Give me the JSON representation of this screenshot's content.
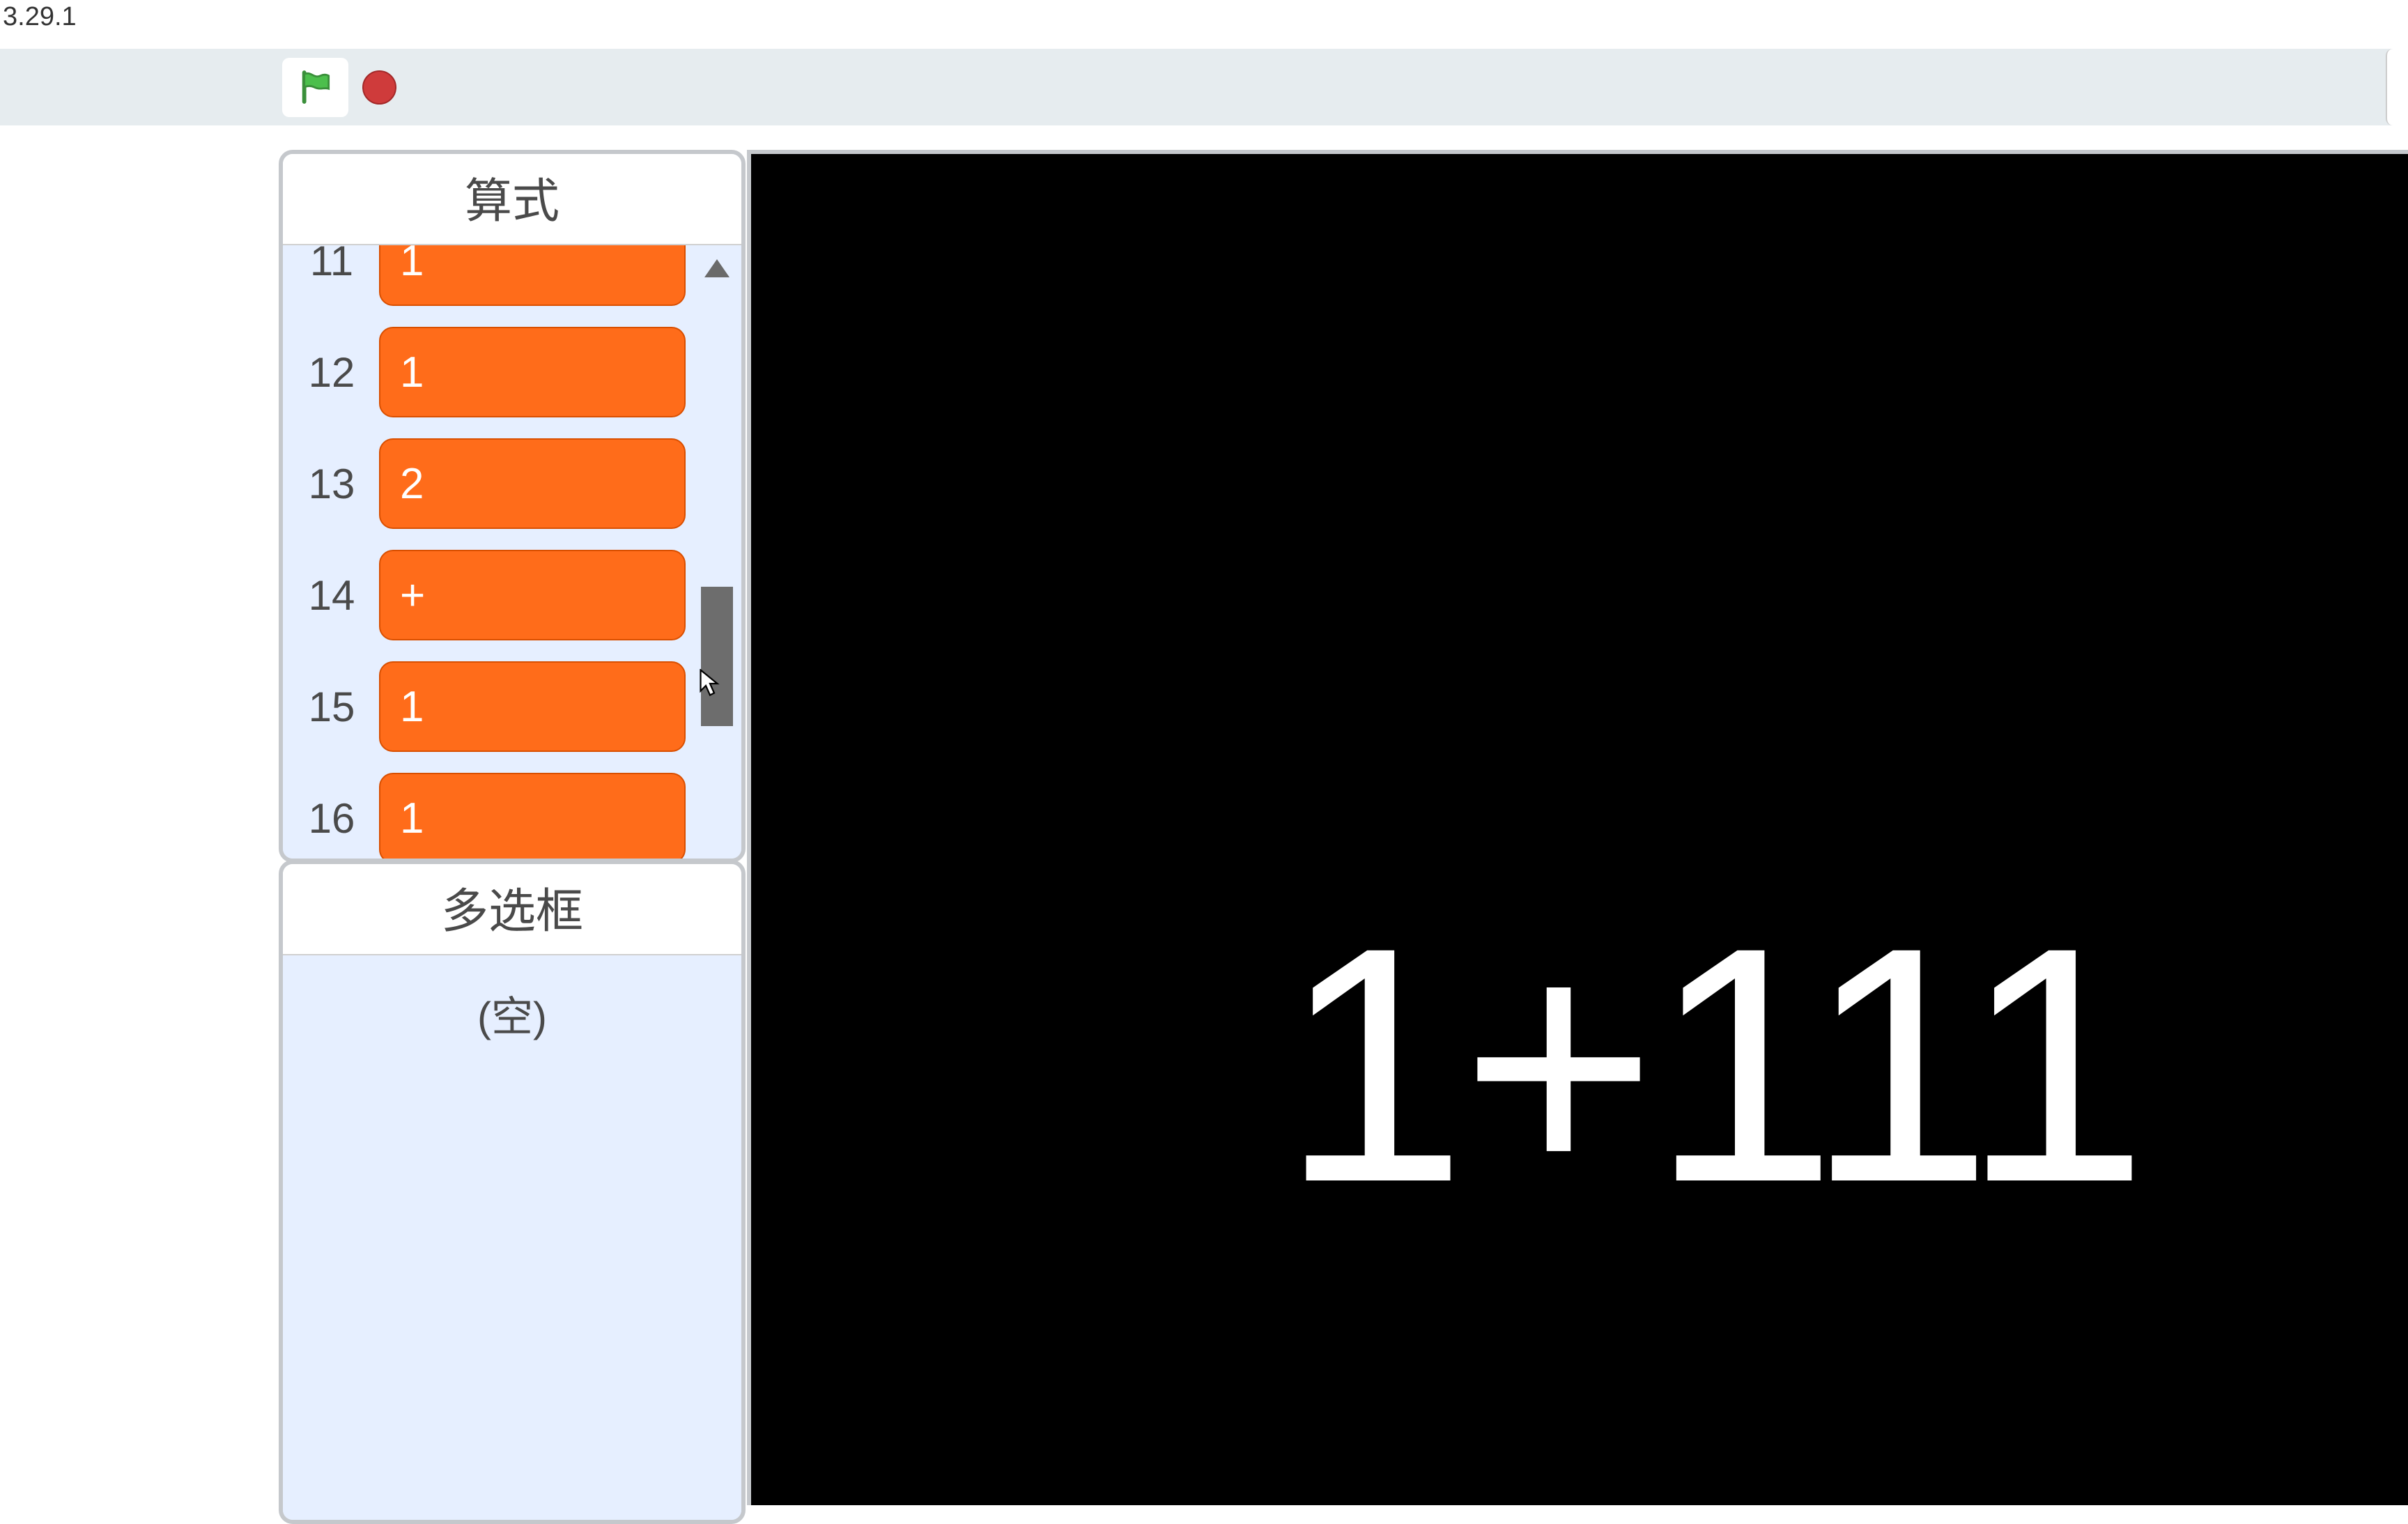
{
  "app": {
    "version": "3.29.1"
  },
  "toolbar": {
    "go_icon": "green-flag-icon",
    "stop_icon": "stop-icon"
  },
  "lists": {
    "expression": {
      "title": "算式",
      "rows": [
        {
          "index": "11",
          "value": "1"
        },
        {
          "index": "12",
          "value": "1"
        },
        {
          "index": "13",
          "value": "2"
        },
        {
          "index": "14",
          "value": "+"
        },
        {
          "index": "15",
          "value": "1"
        },
        {
          "index": "16",
          "value": "1"
        }
      ]
    },
    "multiselect": {
      "title": "多选框",
      "empty_label": "(空)"
    }
  },
  "stage": {
    "display_text": "1+111"
  }
}
